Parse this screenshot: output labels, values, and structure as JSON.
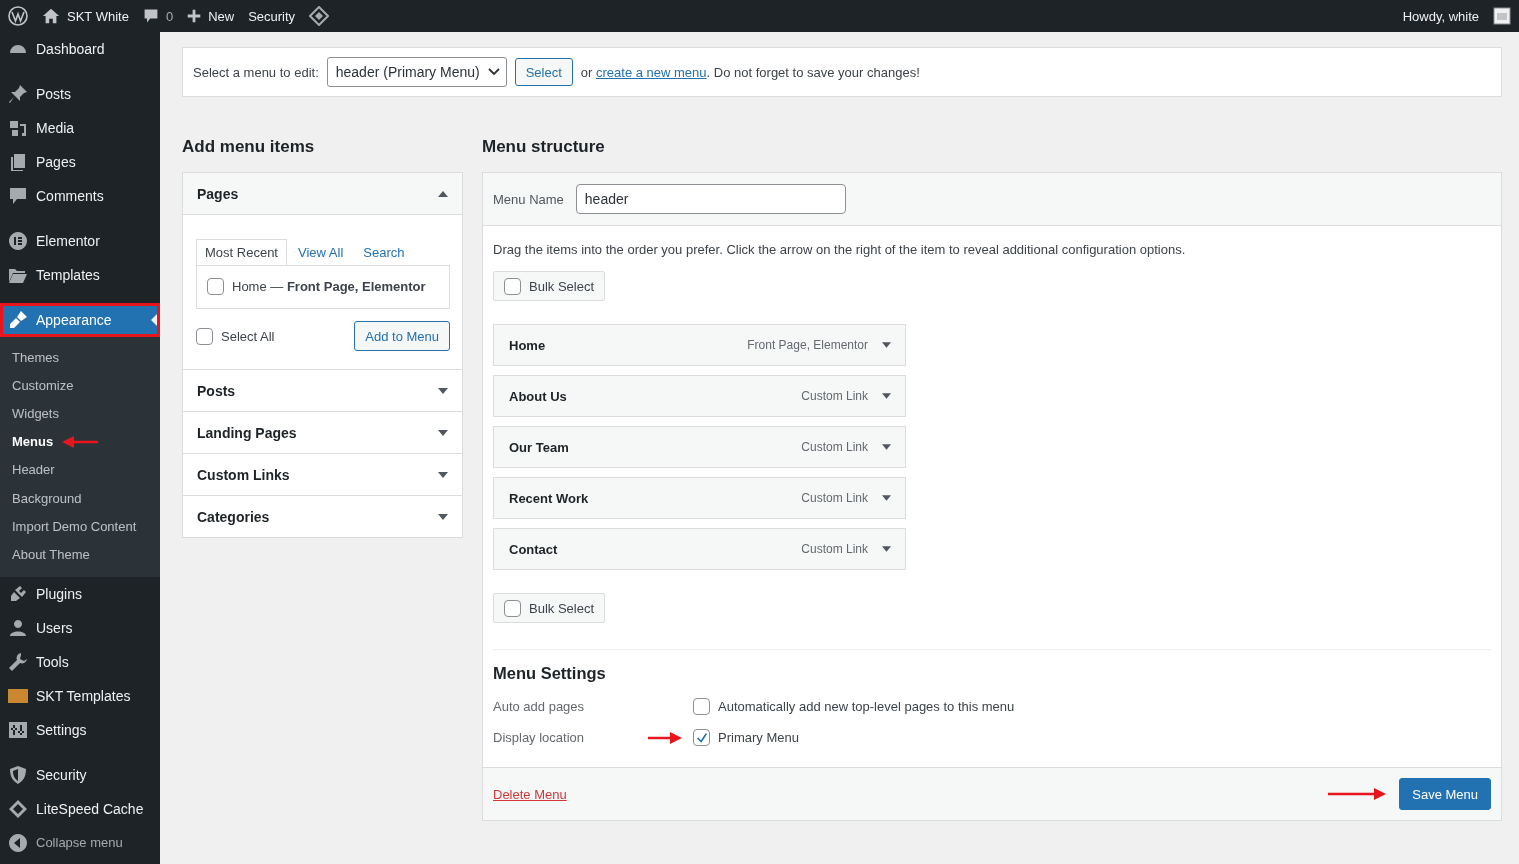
{
  "admin_bar": {
    "site": "SKT White",
    "comments": "0",
    "new": "New",
    "security": "Security",
    "greeting": "Howdy, white"
  },
  "sidebar": {
    "groups": [
      {
        "items": [
          {
            "label": "Dashboard",
            "kind": "dashboard",
            "selected": false
          }
        ]
      },
      {
        "items": [
          {
            "label": "Posts",
            "kind": "pin",
            "selected": false
          },
          {
            "label": "Media",
            "kind": "media",
            "selected": false
          },
          {
            "label": "Pages",
            "kind": "pages",
            "selected": false
          },
          {
            "label": "Comments",
            "kind": "comment",
            "selected": false
          }
        ]
      },
      {
        "items": [
          {
            "label": "Elementor",
            "kind": "elementor",
            "selected": false
          },
          {
            "label": "Templates",
            "kind": "folder",
            "selected": false
          }
        ]
      },
      {
        "items": [
          {
            "label": "Appearance",
            "kind": "brush",
            "selected": true,
            "highlighted": true,
            "children": [
              {
                "label": "Themes",
                "selected": false,
                "annotated": false
              },
              {
                "label": "Customize",
                "selected": false,
                "annotated": false
              },
              {
                "label": "Widgets",
                "selected": false,
                "annotated": false
              },
              {
                "label": "Menus",
                "selected": true,
                "annotated": true
              },
              {
                "label": "Header",
                "selected": false,
                "annotated": false
              },
              {
                "label": "Background",
                "selected": false,
                "annotated": false
              },
              {
                "label": "Import Demo Content",
                "selected": false,
                "annotated": false
              },
              {
                "label": "About Theme",
                "selected": false,
                "annotated": false
              }
            ]
          },
          {
            "label": "Plugins",
            "kind": "plug",
            "selected": false
          },
          {
            "label": "Users",
            "kind": "user",
            "selected": false
          },
          {
            "label": "Tools",
            "kind": "wrench",
            "selected": false
          },
          {
            "label": "SKT Templates",
            "kind": "skt",
            "selected": false
          },
          {
            "label": "Settings",
            "kind": "settings",
            "selected": false
          }
        ]
      },
      {
        "items": [
          {
            "label": "Security",
            "kind": "shield",
            "selected": false
          },
          {
            "label": "LiteSpeed Cache",
            "kind": "diamond",
            "selected": false
          },
          {
            "label": "Collapse menu",
            "kind": "collapse",
            "selected": false
          }
        ]
      }
    ]
  },
  "menu_select": {
    "label": "Select a menu to edit:",
    "value": "header (Primary Menu)",
    "button": "Select",
    "pre_link": "or",
    "link": "create a new menu",
    "post_link": ". Do not forget to save your changes!"
  },
  "add_menu_items": {
    "title": "Add menu items",
    "sections": [
      {
        "title": "Pages",
        "expanded": true,
        "tabs": [
          {
            "label": "Most Recent",
            "selected": true
          },
          {
            "label": "View All",
            "selected": false
          },
          {
            "label": "Search",
            "selected": false
          }
        ],
        "options": [
          {
            "label": "Home — **Front Page, Elementor**",
            "checked": false
          }
        ],
        "select_all": {
          "label": "Select All",
          "checked": false
        },
        "button": "Add to Menu"
      },
      {
        "title": "Posts",
        "expanded": false
      },
      {
        "title": "Landing Pages",
        "expanded": false
      },
      {
        "title": "Custom Links",
        "expanded": false
      },
      {
        "title": "Categories",
        "expanded": false
      }
    ]
  },
  "menu_structure": {
    "title": "Menu structure",
    "name_label": "Menu Name",
    "name_value": "header",
    "instructions": "Drag the items into the order you prefer. Click the arrow on the right of the item to reveal additional configuration options.",
    "bulk_select_top": {
      "label": "Bulk Select",
      "checked": false
    },
    "items": [
      {
        "title": "Home",
        "type": "Front Page, Elementor"
      },
      {
        "title": "About Us",
        "type": "Custom Link"
      },
      {
        "title": "Our Team",
        "type": "Custom Link"
      },
      {
        "title": "Recent Work",
        "type": "Custom Link"
      },
      {
        "title": "Contact",
        "type": "Custom Link"
      }
    ],
    "bulk_select_bottom": {
      "label": "Bulk Select",
      "checked": false
    },
    "settings_title": "Menu Settings",
    "settings": [
      {
        "label": "Auto add pages",
        "option": "Automatically add new top-level pages to this menu",
        "checked": false,
        "annotated": false
      },
      {
        "label": "Display location",
        "option": "Primary Menu",
        "checked": true,
        "annotated": true
      }
    ],
    "delete_link": "Delete Menu",
    "save_button": {
      "label": "Save Menu",
      "annotated": true
    }
  }
}
